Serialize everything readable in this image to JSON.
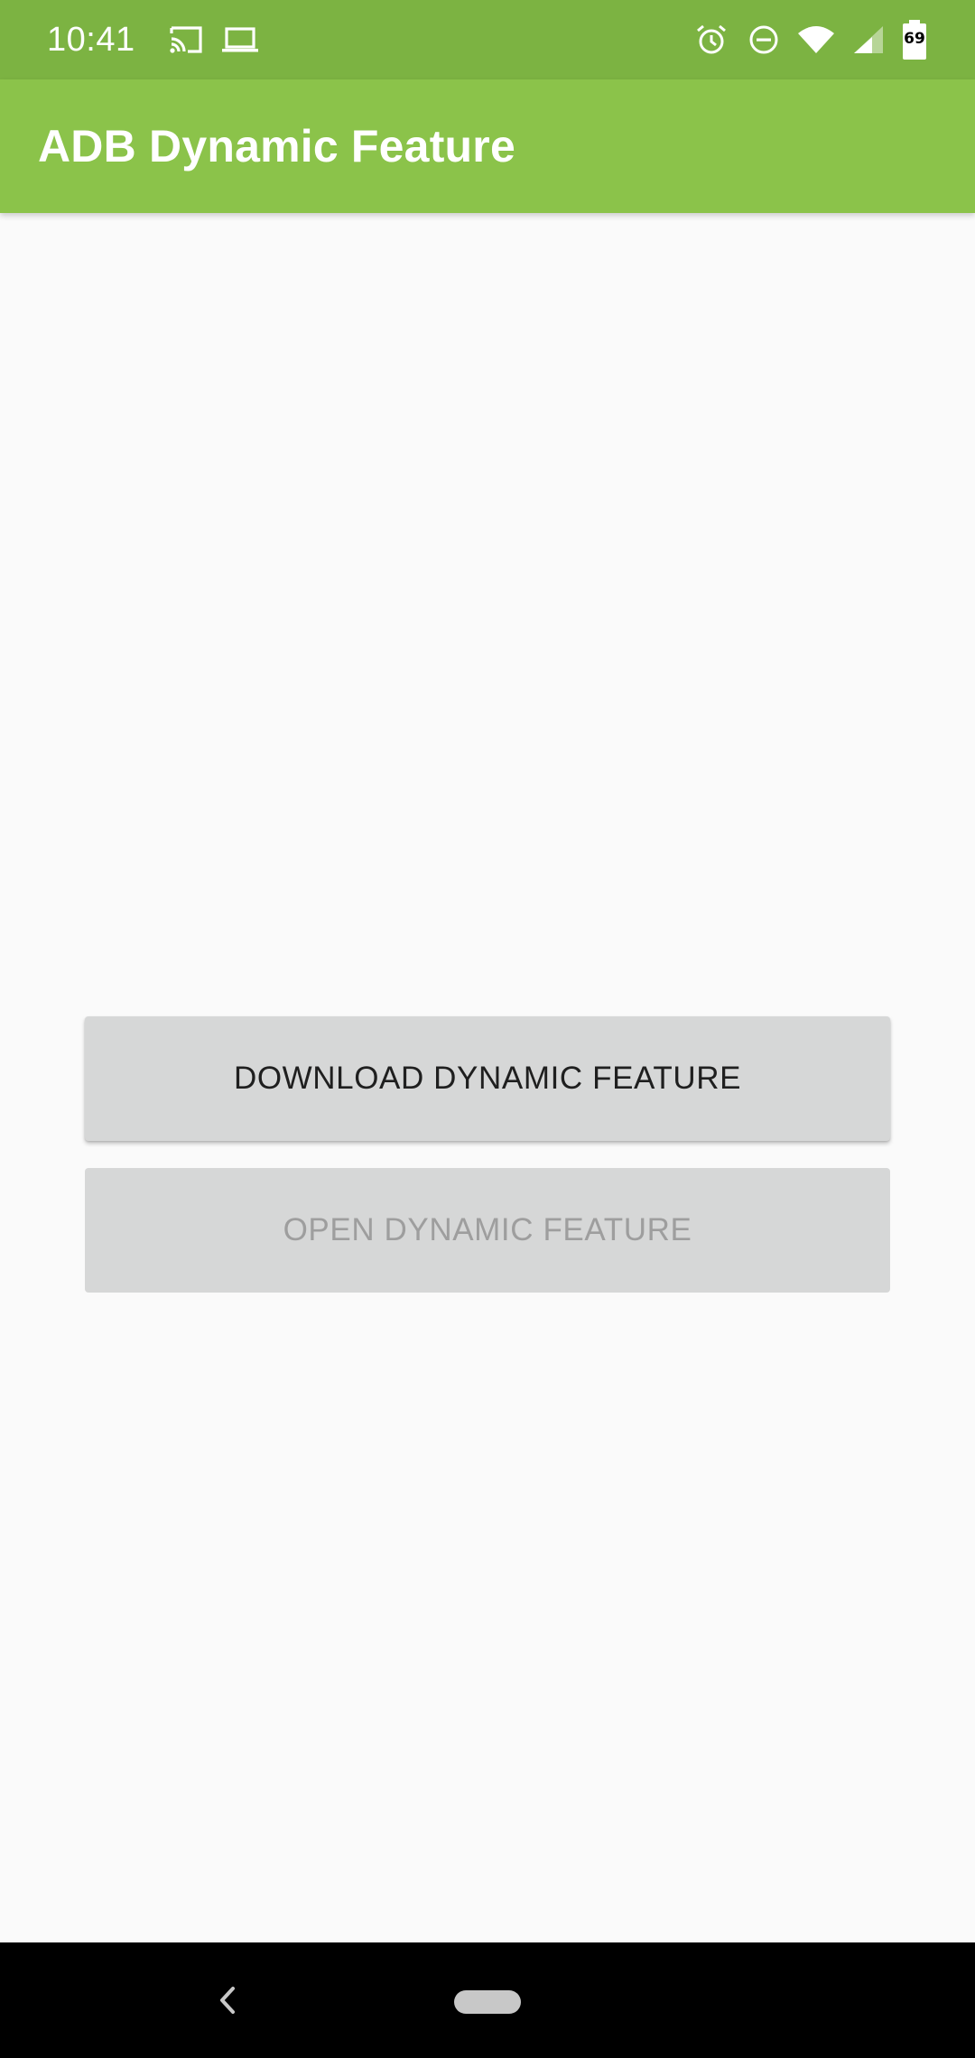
{
  "status_bar": {
    "time": "10:41",
    "left_icons": [
      "cast-icon",
      "laptop-icon"
    ],
    "right_icons": [
      "alarm-icon",
      "do-not-disturb-icon",
      "wifi-icon",
      "cell-signal-icon",
      "battery-icon"
    ],
    "battery_level": "69"
  },
  "app_bar": {
    "title": "ADB Dynamic Feature",
    "color": "#8bc34a"
  },
  "main": {
    "download_button": {
      "label": "DOWNLOAD DYNAMIC FEATURE",
      "enabled": true
    },
    "open_button": {
      "label": "OPEN DYNAMIC FEATURE",
      "enabled": false
    }
  },
  "colors": {
    "status_bar": "#7cb342",
    "app_bar": "#8bc34a",
    "background": "#fafafa",
    "button": "#d6d7d7"
  }
}
